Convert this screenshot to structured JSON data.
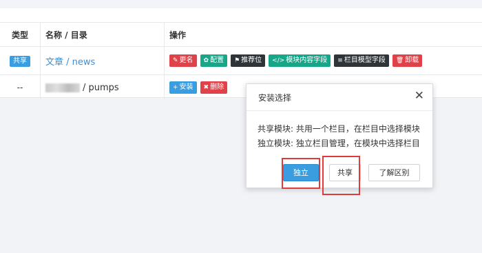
{
  "table": {
    "headers": {
      "type": "类型",
      "name": "名称 / 目录",
      "ops": "操作"
    },
    "rows": [
      {
        "type_badge": "共享",
        "name": "文章 / news",
        "actions": [
          {
            "label": "更名",
            "icon": "edit-icon",
            "glyph": "✎",
            "color": "#e0424a"
          },
          {
            "label": "配置",
            "icon": "gear-icon",
            "glyph": "✿",
            "color": "#18a689"
          },
          {
            "label": "推荐位",
            "icon": "flag-icon",
            "glyph": "⚑",
            "color": "#2f3438"
          },
          {
            "label": "模块内容字段",
            "icon": "code-icon",
            "glyph": "</>",
            "color": "#18a689"
          },
          {
            "label": "栏目模型字段",
            "icon": "list-icon",
            "glyph": "≡",
            "color": "#2f3438"
          },
          {
            "label": "卸载",
            "icon": "trash-icon",
            "glyph": "🗑",
            "color": "#e0424a"
          }
        ]
      },
      {
        "type_text": "--",
        "name_suffix": "/ pumps",
        "actions": [
          {
            "label": "安装",
            "icon": "plus-icon",
            "glyph": "+",
            "color": "#3a9de0"
          },
          {
            "label": "删除",
            "icon": "close-icon",
            "glyph": "✖",
            "color": "#e0424a"
          }
        ]
      }
    ]
  },
  "modal": {
    "title": "安装选择",
    "close_glyph": "✕",
    "lines": [
      "共享模块: 共用一个栏目，在栏目中选择模块",
      "独立模块: 独立栏目管理，在模块中选择栏目"
    ],
    "buttons": {
      "independent": "独立",
      "share": "共享",
      "diff": "了解区别"
    }
  },
  "colors": {
    "primary": "#3a9de0",
    "danger": "#e0424a",
    "success": "#18a689",
    "dark": "#2f3438",
    "highlight": "#e03a3a"
  }
}
